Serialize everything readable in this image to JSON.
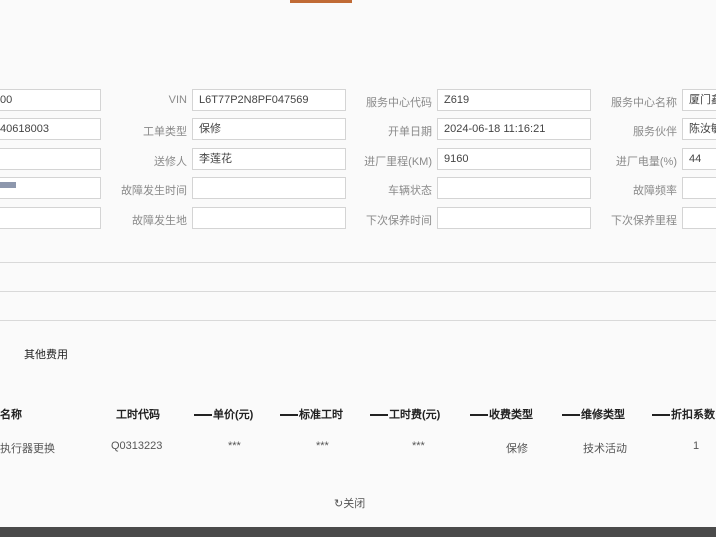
{
  "form": {
    "row1": {
      "field0_value": "00",
      "vin_label": "VIN",
      "vin_value": "L6T77P2N8PF047569",
      "service_code_label": "服务中心代码",
      "service_code_value": "Z619",
      "service_name_label": "服务中心名称",
      "service_name_value": "厦门鑫"
    },
    "row2": {
      "field0_value": "40618003",
      "order_type_label": "工单类型",
      "order_type_value": "保修",
      "open_date_label": "开单日期",
      "open_date_value": "2024-06-18 11:16:21",
      "advisor_label": "服务伙伴",
      "advisor_value": "陈汝敏"
    },
    "row3": {
      "sender_label": "送修人",
      "sender_value": "李莲花",
      "mileage_label": "进厂里程(KM)",
      "mileage_value": "9160",
      "battery_label": "进厂电量(%)",
      "battery_value": "44"
    },
    "row4": {
      "fault_time_label": "故障发生时间",
      "vehicle_status_label": "车辆状态",
      "fault_freq_label": "故障频率"
    },
    "row5": {
      "fault_place_label": "故障发生地",
      "next_maint_time_label": "下次保养时间",
      "next_maint_mileage_label": "下次保养里程"
    }
  },
  "tabs": {
    "other_fees": "其他费用"
  },
  "table": {
    "headers": {
      "name": "名称",
      "labor_code": "工时代码",
      "unit_price": "单价(元)",
      "std_hours": "标准工时",
      "labor_fee": "工时费(元)",
      "charge_type": "收费类型",
      "repair_type": "维修类型",
      "discount": "折扣系数"
    },
    "rows": [
      {
        "name": "执行器更换",
        "labor_code": "Q0313223",
        "unit_price": "***",
        "std_hours": "***",
        "labor_fee": "***",
        "charge_type": "保修",
        "repair_type": "技术活动",
        "discount": "1"
      }
    ]
  },
  "footer": {
    "close_label": "关闭",
    "close_icon": "refresh-icon"
  }
}
